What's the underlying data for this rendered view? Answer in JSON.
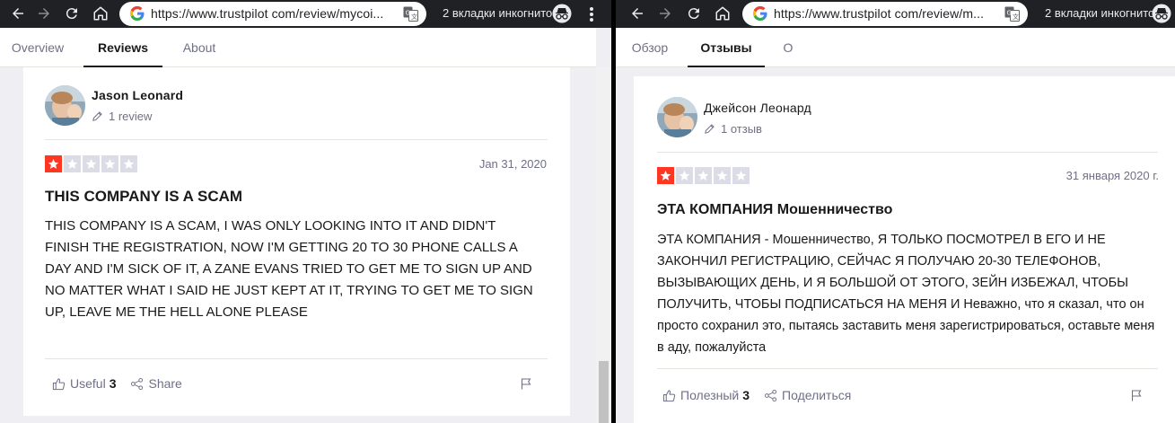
{
  "left": {
    "url": "https://www.trustpilot com/review/mycoi...",
    "incognito_label": "2 вкладки инкогнито",
    "tabs": [
      {
        "label": "Overview",
        "active": false
      },
      {
        "label": "Reviews",
        "active": true
      },
      {
        "label": "About",
        "active": false
      }
    ],
    "review": {
      "user_name": "Jason Leonard",
      "review_count": "1 review",
      "rating": 1,
      "max_rating": 5,
      "date": "Jan 31, 2020",
      "title": "THIS COMPANY IS A SCAM",
      "body": "THIS COMPANY IS A SCAM, I WAS ONLY LOOKING INTO IT AND DIDN'T FINISH THE REGISTRATION, NOW I'M GETTING 20 TO 30 PHONE CALLS A DAY AND I'M SICK OF IT, A ZANE EVANS TRIED TO GET ME TO SIGN UP AND NO MATTER WHAT I SAID HE JUST KEPT AT IT, TRYING TO GET ME TO SIGN UP, LEAVE ME THE HELL ALONE PLEASE",
      "useful_label": "Useful",
      "useful_count": "3",
      "share_label": "Share"
    }
  },
  "right": {
    "url": "https://www.trustpilot com/review/m...",
    "incognito_label": "2 вкладки инкогнито",
    "tabs": [
      {
        "label": "Обзор",
        "active": false
      },
      {
        "label": "Отзывы",
        "active": true
      },
      {
        "label": "О",
        "active": false
      }
    ],
    "review": {
      "user_name": "Джейсон Леонард",
      "review_count": "1 отзыв",
      "rating": 1,
      "max_rating": 5,
      "date": "31 января 2020 г.",
      "title": "ЭТА КОМПАНИЯ Мошенничество",
      "body": "ЭТА КОМПАНИЯ - Мошенничество, Я ТОЛЬКО ПОСМОТРЕЛ В ЕГО И НЕ ЗАКОНЧИЛ РЕГИСТРАЦИЮ, СЕЙЧАС Я ПОЛУЧАЮ 20-30 ТЕЛЕФОНОВ, ВЫЗЫВАЮЩИХ ДЕНЬ, И Я БОЛЬШОЙ ОТ ЭТОГО, ЗЕЙН ИЗБЕЖАЛ, ЧТОБЫ ПОЛУЧИТЬ, ЧТОБЫ ПОДПИСАТЬСЯ НА МЕНЯ И Неважно, что я сказал, что он просто сохранил это, пытаясь заставить меня зарегистрироваться, оставьте меня в аду, пожалуйста",
      "useful_label": "Полезный",
      "useful_count": "3",
      "share_label": "Поделиться"
    }
  },
  "colors": {
    "star_on": "#ff3722",
    "star_off": "#dcdce6",
    "toolbar": "#202124",
    "page_bg": "#eeeef3"
  },
  "icons": [
    "back-arrow-icon",
    "forward-arrow-icon",
    "reload-icon",
    "home-icon",
    "google-icon",
    "translate-icon",
    "incognito-icon",
    "menu-dots-icon",
    "pencil-icon",
    "star-icon",
    "thumbs-up-icon",
    "share-icon",
    "flag-icon"
  ]
}
